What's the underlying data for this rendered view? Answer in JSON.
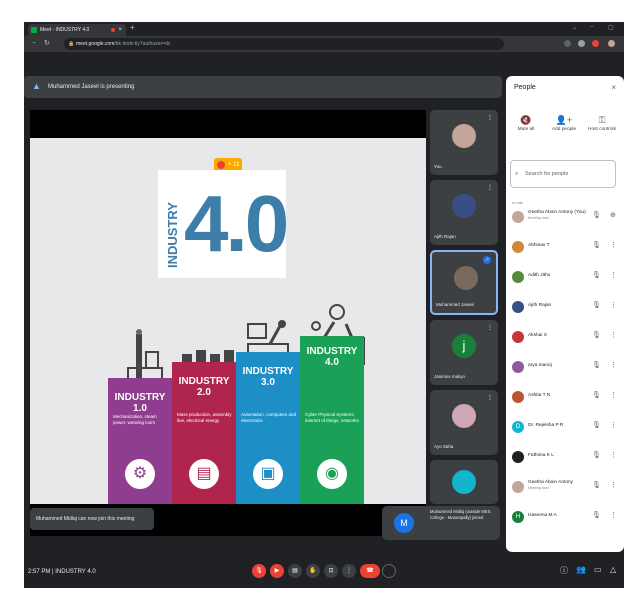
{
  "browser": {
    "tab_title": "Meet - INDUSTRY 4.0",
    "new_tab": "+",
    "url_host": "meet.google.com",
    "url_path": "/bk-lmdv-tiy?authuser=dc",
    "window_controls": [
      "⌄",
      "–",
      "▢"
    ]
  },
  "presenter_bar": {
    "text": "Muhammed Jaseel is presenting"
  },
  "slide": {
    "share_label": "+ 11",
    "logo_text": "INDUSTRY",
    "logo_number": "4.0",
    "columns": [
      {
        "title": "INDUSTRY 1.0",
        "desc": "Mechanization, steam power, weaving loom",
        "color": "#8e3d8f",
        "icon": "⚙"
      },
      {
        "title": "INDUSTRY 2.0",
        "desc": "Mass production, assembly line, electrical energy",
        "color": "#b0254e",
        "icon": "▤"
      },
      {
        "title": "INDUSTRY 3.0",
        "desc": "Automation, computers and electronics",
        "color": "#1e8fc6",
        "icon": "▣"
      },
      {
        "title": "INDUSTRY 4.0",
        "desc": "Cyber Physical Systems, internet of things, networks",
        "color": "#1aa157",
        "icon": "◉"
      }
    ]
  },
  "notification": {
    "text": "Muhammed Midlaj can now join this meeting"
  },
  "tiles": [
    {
      "name": "You",
      "avatar_color": "#c4a59a",
      "initial": ""
    },
    {
      "name": "Ajith Rajan",
      "avatar_color": "#3a4e86",
      "initial": ""
    },
    {
      "name": "Muhammed Jaseel",
      "avatar_color": "#7a6a5e",
      "initial": ""
    },
    {
      "name": "Jasmine maliyn",
      "avatar_color": "#188038",
      "initial": "j"
    },
    {
      "name": "Ayo Saha",
      "avatar_color": "#d0a7b5",
      "initial": ""
    }
  ],
  "popup": {
    "initial": "M",
    "text": "Muhammed Midlaj (outside MES College - Marampally) joined"
  },
  "toolbar": {
    "time_meeting": "2:57 PM  |  INDUSTRY 4.0",
    "mic_color": "#ea4335",
    "end_color": "#ea4335"
  },
  "people_panel": {
    "title": "People",
    "close": "×",
    "actions": [
      {
        "icon": "🔇",
        "label": "Mute all"
      },
      {
        "icon": "👤+",
        "label": "Add people"
      },
      {
        "icon": "⚿",
        "label": "Host controls"
      }
    ],
    "search_placeholder": "Search for people",
    "section_label": "In call",
    "participants": [
      {
        "name": "Geetha Aboin Antony (You)",
        "sub": "Meeting host",
        "color": "#c4a59a",
        "initial": ""
      },
      {
        "name": "Abhinav T",
        "sub": "",
        "color": "#d1883a",
        "initial": ""
      },
      {
        "name": "Adith Jithu",
        "sub": "",
        "color": "#58893f",
        "initial": ""
      },
      {
        "name": "Ajith Rajan",
        "sub": "",
        "color": "#3a4e86",
        "initial": ""
      },
      {
        "name": "Akshai S",
        "sub": "",
        "color": "#c5363c",
        "initial": ""
      },
      {
        "name": "arya manoj",
        "sub": "",
        "color": "#8f5a9b",
        "initial": ""
      },
      {
        "name": "Ashita T N",
        "sub": "",
        "color": "#b8562f",
        "initial": ""
      },
      {
        "name": "Dr. Rejeisha P R",
        "sub": "",
        "color": "#12b5cb",
        "initial": "D"
      },
      {
        "name": "Fathima K L",
        "sub": "",
        "color": "#202124",
        "initial": ""
      },
      {
        "name": "Geetha Aboin Antony",
        "sub": "Meeting host",
        "color": "#c4a59a",
        "initial": ""
      },
      {
        "name": "Haseena M A",
        "sub": "",
        "color": "#188038",
        "initial": "H"
      }
    ]
  }
}
